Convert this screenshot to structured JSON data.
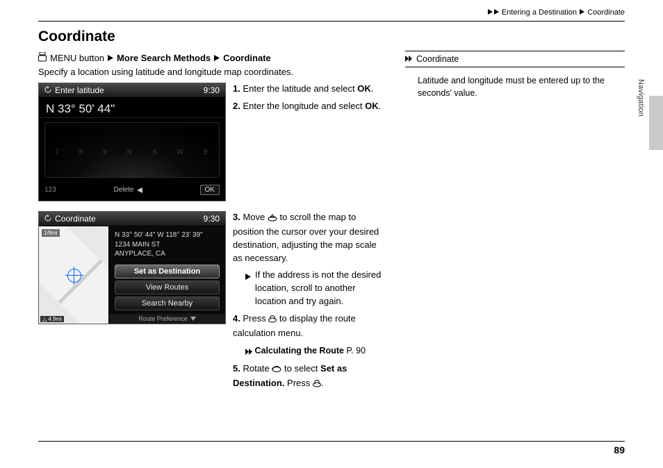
{
  "breadcrumb": {
    "l1": "Entering a Destination",
    "l2": "Coordinate"
  },
  "heading": "Coordinate",
  "path": {
    "pre": "MENU button",
    "mid": "More Search Methods",
    "end": "Coordinate"
  },
  "intro": "Specify a location using latitude and longitude map coordinates.",
  "shot1": {
    "title": "Enter latitude",
    "clock": "9:30",
    "value": "N 33° 50' 44\"",
    "keypad_label": "123",
    "delete": "Delete",
    "ok": "OK"
  },
  "steps_a": {
    "s1": {
      "n": "1.",
      "t_a": "Enter the latitude and select ",
      "ok": "OK",
      "t_b": "."
    },
    "s2": {
      "n": "2.",
      "t_a": "Enter the longitude and select ",
      "ok": "OK",
      "t_b": "."
    }
  },
  "shot2": {
    "title": "Coordinate",
    "clock": "9:30",
    "scale": "1/8mi",
    "dist": "4.9mi",
    "addr1": "N 33° 50' 44\" W 118° 23' 39\"",
    "addr2": "1234 MAIN ST",
    "addr3": "ANYPLACE, CA",
    "m1": "Set as Destination",
    "m2": "View Routes",
    "m3": "Search Nearby",
    "foot": "Route Preference"
  },
  "steps_b": {
    "s3": {
      "n": "3.",
      "t": "Move         to scroll the map to position the cursor over your desired destination, adjusting the map scale as necessary.",
      "sub": "If the address is not the desired location, scroll to another location and try again."
    },
    "s4": {
      "n": "4.",
      "t": "Press        to display the route calculation menu."
    },
    "xref": {
      "label": "Calculating the Route",
      "page": "P. 90"
    },
    "s5": {
      "n": "5.",
      "t_a": "Rotate        to select ",
      "bold": "Set as Destination.",
      "t_b": " Press        ."
    }
  },
  "side": {
    "title": "Coordinate",
    "body": "Latitude and longitude must be entered up to the seconds' value."
  },
  "section_tab": "Navigation",
  "page_number": "89"
}
